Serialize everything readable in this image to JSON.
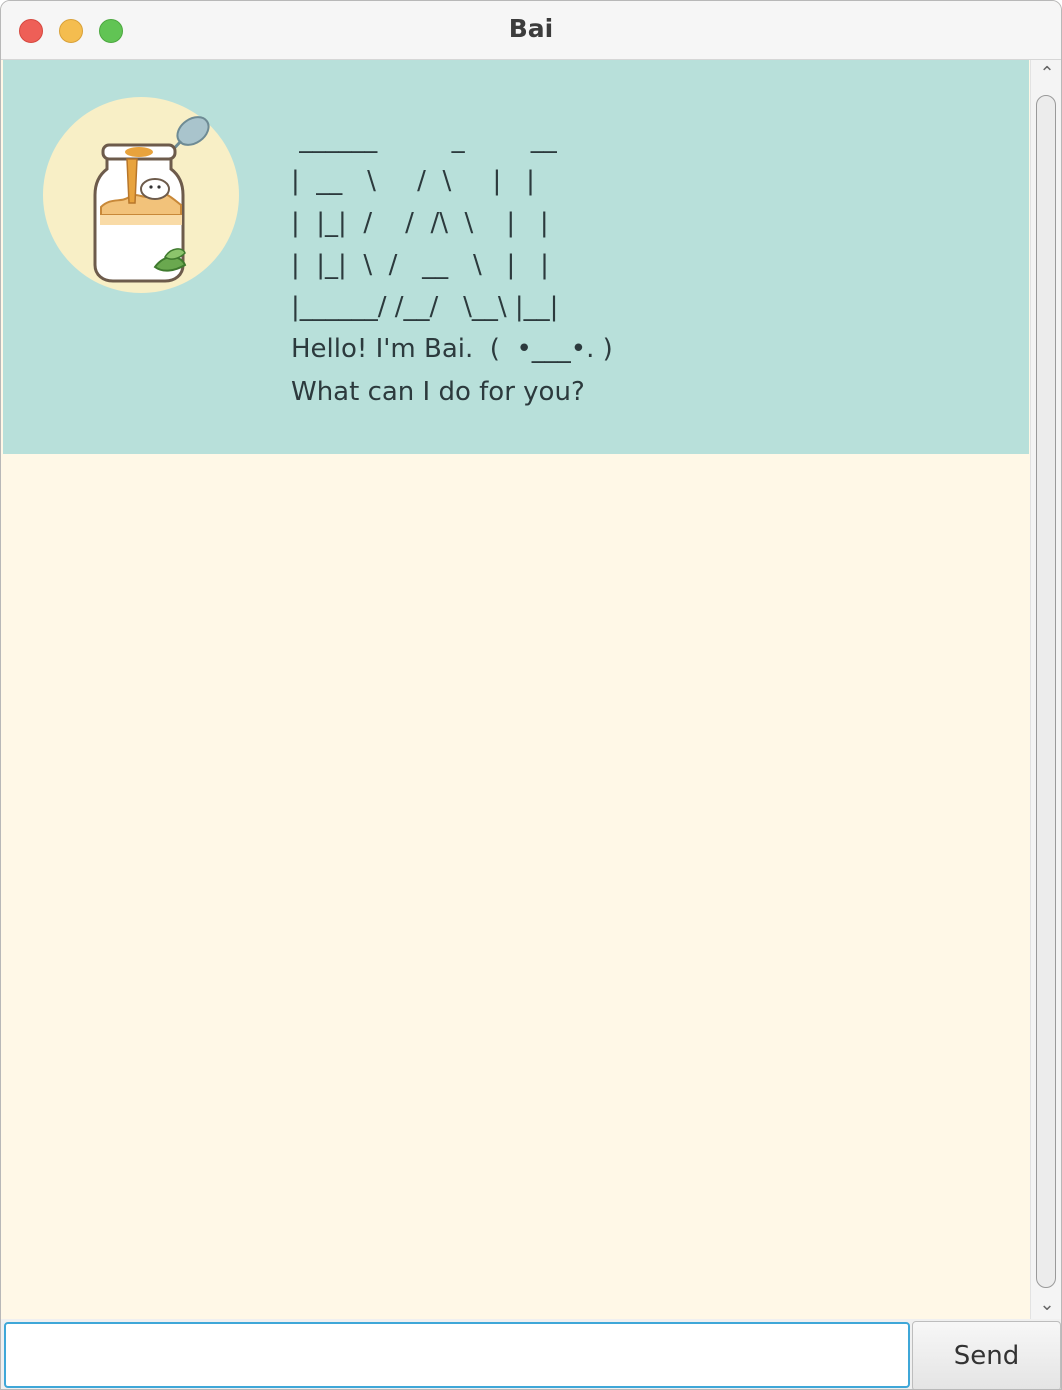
{
  "window": {
    "title": "Bai"
  },
  "chat": {
    "messages": [
      {
        "sender": "bot",
        "avatar_icon": "pudding-jar-icon",
        "ascii_banner": [
          " ______         _        __",
          "|  __   \\     /  \\     |   |",
          "|  |_|  /    /  /\\  \\    |   |",
          "|  |_|  \\  /   __   \\   |   |",
          "|______/ /__/   \\__\\ |__|"
        ],
        "lines": [
          "Hello! I'm Bai.  (  •___•. )",
          "What can I do for you?"
        ]
      }
    ]
  },
  "input": {
    "value": "",
    "placeholder": ""
  },
  "send_button": {
    "label": "Send"
  },
  "colors": {
    "dialog_bg": "#b8e0da",
    "chat_bg": "#fff8e7",
    "input_border": "#3fa7d8"
  }
}
